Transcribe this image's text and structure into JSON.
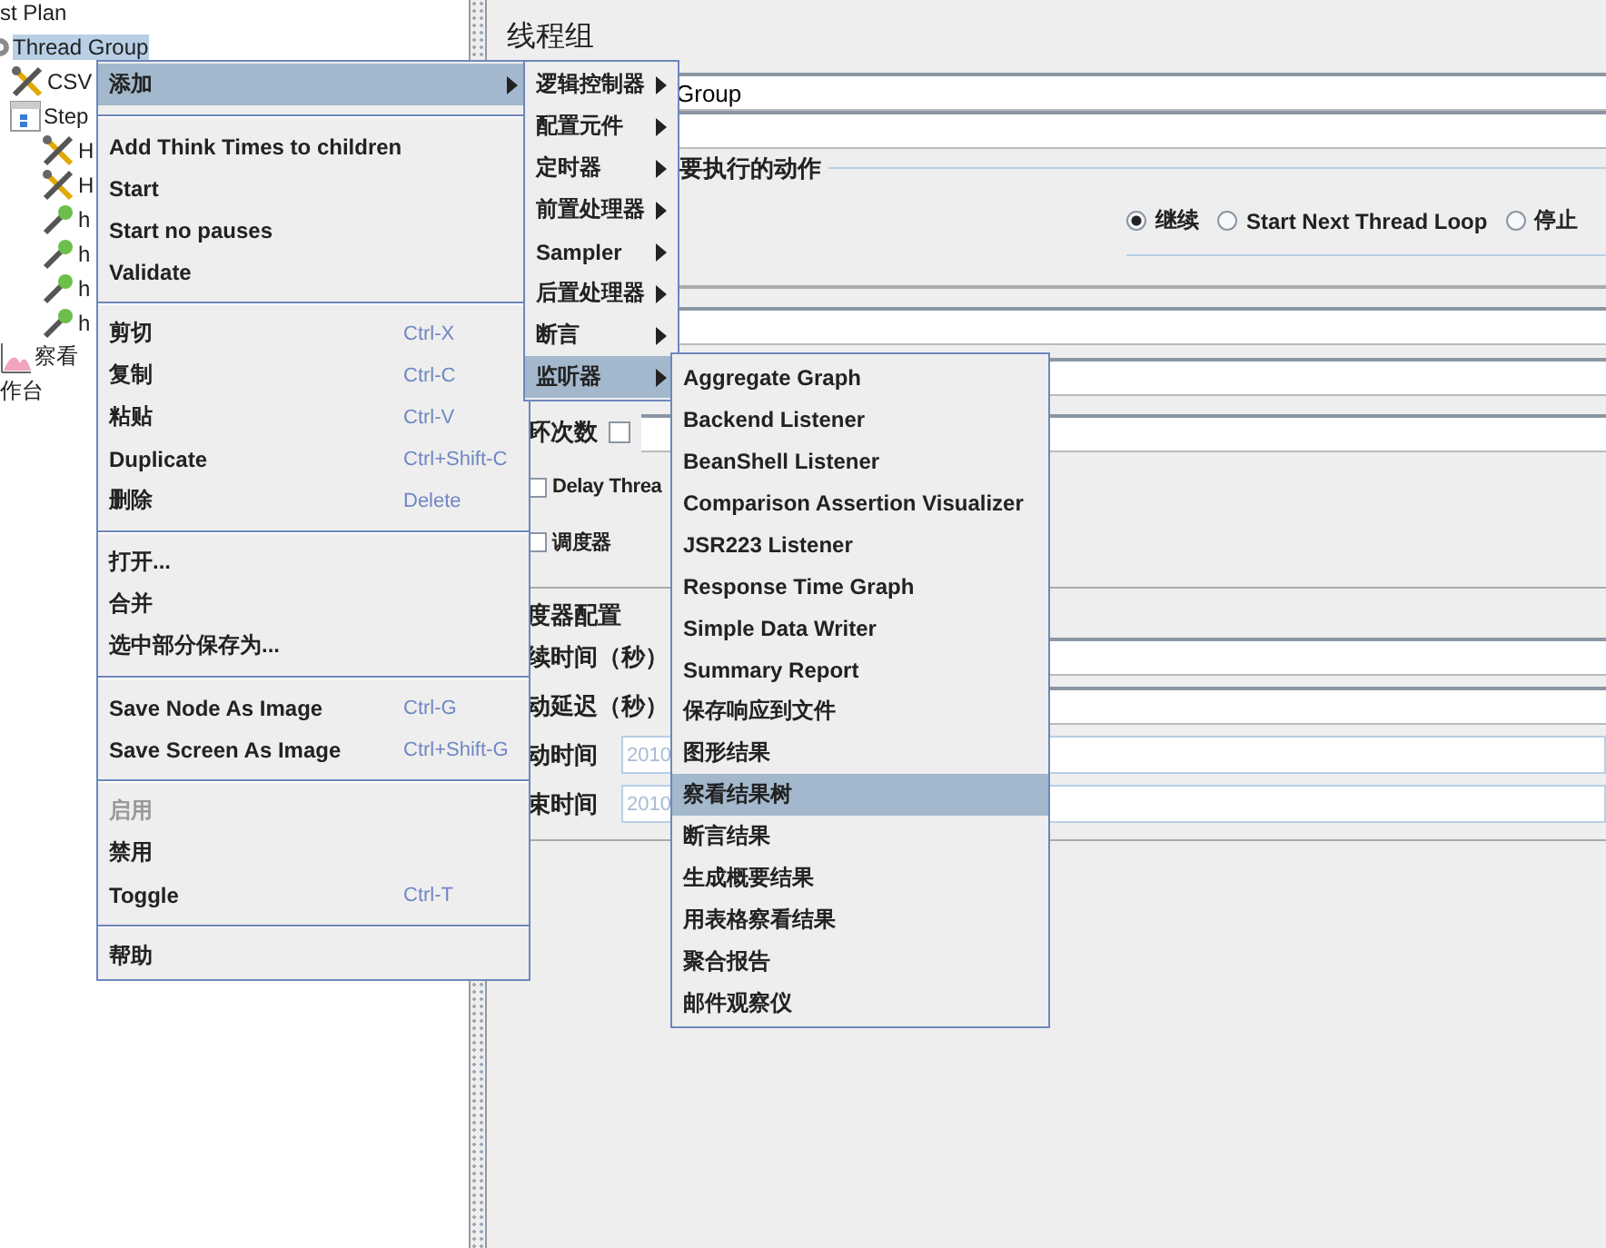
{
  "tree": [
    {
      "label": "st Plan",
      "selected": false,
      "children": [
        {
          "label": "Thread Group",
          "kind": "gear",
          "selected": true,
          "children": [
            {
              "label": "CSV",
              "kind": "tools",
              "selected": false
            },
            {
              "label": "Step",
              "kind": "step",
              "selected": false,
              "children": [
                {
                  "label": "H",
                  "kind": "tools",
                  "selected": false
                },
                {
                  "label": "H",
                  "kind": "tools",
                  "selected": false
                },
                {
                  "label": "h",
                  "kind": "pipette",
                  "selected": false
                },
                {
                  "label": "h",
                  "kind": "pipette",
                  "selected": false
                },
                {
                  "label": "h",
                  "kind": "pipette",
                  "selected": false
                },
                {
                  "label": "h",
                  "kind": "pipette",
                  "selected": false
                }
              ]
            }
          ]
        },
        {
          "label": "察看",
          "kind": "graph",
          "selected": false
        }
      ]
    },
    {
      "label": "作台",
      "selected": false
    }
  ],
  "panel": {
    "title": "线程组",
    "name_field": {
      "value": "Group"
    },
    "action_section": {
      "title": "要执行的动作",
      "options": [
        {
          "label": "继续",
          "selected": true
        },
        {
          "label": "Start Next Thread Loop",
          "selected": false
        },
        {
          "label": "停止",
          "selected": false
        }
      ]
    },
    "loop_count": {
      "label": "环次数",
      "checked": false
    },
    "checkboxes": [
      {
        "label": "Delay Threa",
        "checked": false
      },
      {
        "label": "调度器",
        "checked": false
      }
    ],
    "scheduler": {
      "title": "度器配置",
      "rows": [
        {
          "label": "续时间（秒）",
          "kind": "plain"
        },
        {
          "label": "动延迟（秒）",
          "kind": "plain"
        },
        {
          "label": "动时间",
          "kind": "date",
          "value": "2010"
        },
        {
          "label": "束时间",
          "kind": "date",
          "value": "2010"
        }
      ]
    }
  },
  "context_menu": {
    "groups": [
      [
        {
          "label": "添加",
          "selected": true,
          "submenu": true,
          "disabled": false
        }
      ],
      [
        {
          "label": "Add Think Times to children",
          "selected": false,
          "disabled": false
        },
        {
          "label": "Start",
          "selected": false,
          "disabled": false
        },
        {
          "label": "Start no pauses",
          "selected": false,
          "disabled": false
        },
        {
          "label": "Validate",
          "selected": false,
          "disabled": false
        }
      ],
      [
        {
          "label": "剪切",
          "shortcut": "Ctrl-X",
          "selected": false,
          "disabled": false
        },
        {
          "label": "复制",
          "shortcut": "Ctrl-C",
          "selected": false,
          "disabled": false
        },
        {
          "label": "粘贴",
          "shortcut": "Ctrl-V",
          "selected": false,
          "disabled": false
        },
        {
          "label": "Duplicate",
          "shortcut": "Ctrl+Shift-C",
          "selected": false,
          "disabled": false
        },
        {
          "label": "删除",
          "shortcut": "Delete",
          "selected": false,
          "disabled": false
        }
      ],
      [
        {
          "label": "打开...",
          "selected": false,
          "disabled": false
        },
        {
          "label": "合并",
          "selected": false,
          "disabled": false
        },
        {
          "label": "选中部分保存为...",
          "selected": false,
          "disabled": false
        }
      ],
      [
        {
          "label": "Save Node As Image",
          "shortcut": "Ctrl-G",
          "selected": false,
          "disabled": false
        },
        {
          "label": "Save Screen As Image",
          "shortcut": "Ctrl+Shift-G",
          "selected": false,
          "disabled": false
        }
      ],
      [
        {
          "label": "启用",
          "selected": false,
          "disabled": true
        },
        {
          "label": "禁用",
          "selected": false,
          "disabled": false
        },
        {
          "label": "Toggle",
          "shortcut": "Ctrl-T",
          "selected": false,
          "disabled": false
        }
      ],
      [
        {
          "label": "帮助",
          "selected": false,
          "disabled": false
        }
      ]
    ]
  },
  "add_submenu": [
    {
      "label": "逻辑控制器",
      "selected": false,
      "submenu": true
    },
    {
      "label": "配置元件",
      "selected": false,
      "submenu": true
    },
    {
      "label": "定时器",
      "selected": false,
      "submenu": true
    },
    {
      "label": "前置处理器",
      "selected": false,
      "submenu": true
    },
    {
      "label": "Sampler",
      "selected": false,
      "submenu": true
    },
    {
      "label": "后置处理器",
      "selected": false,
      "submenu": true
    },
    {
      "label": "断言",
      "selected": false,
      "submenu": true
    },
    {
      "label": "监听器",
      "selected": true,
      "submenu": true
    }
  ],
  "listener_submenu": [
    {
      "label": "Aggregate Graph",
      "selected": false
    },
    {
      "label": "Backend Listener",
      "selected": false
    },
    {
      "label": "BeanShell Listener",
      "selected": false
    },
    {
      "label": "Comparison Assertion Visualizer",
      "selected": false
    },
    {
      "label": "JSR223 Listener",
      "selected": false
    },
    {
      "label": "Response Time Graph",
      "selected": false
    },
    {
      "label": "Simple Data Writer",
      "selected": false
    },
    {
      "label": "Summary Report",
      "selected": false
    },
    {
      "label": "保存响应到文件",
      "selected": false
    },
    {
      "label": "图形结果",
      "selected": false
    },
    {
      "label": "察看结果树",
      "selected": true
    },
    {
      "label": "断言结果",
      "selected": false
    },
    {
      "label": "生成概要结果",
      "selected": false
    },
    {
      "label": "用表格察看结果",
      "selected": false
    },
    {
      "label": "聚合报告",
      "selected": false
    },
    {
      "label": "邮件观察仪",
      "selected": false
    }
  ]
}
